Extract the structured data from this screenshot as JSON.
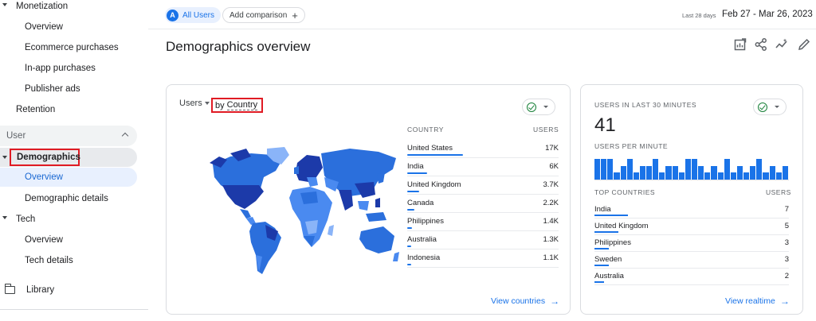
{
  "sidebar": {
    "monetization": "Monetization",
    "overview_1": "Overview",
    "ecommerce": "Ecommerce purchases",
    "inapp": "In-app purchases",
    "publisher": "Publisher ads",
    "retention": "Retention",
    "user_section": "User",
    "demographics": "Demographics",
    "overview_2": "Overview",
    "demo_details": "Demographic details",
    "tech": "Tech",
    "overview_3": "Overview",
    "tech_details": "Tech details",
    "library": "Library"
  },
  "topbar": {
    "all_users_avatar": "A",
    "all_users": "All Users",
    "add_comparison": "Add comparison",
    "date_hint": "Last 28 days",
    "date_range": "Feb 27 - Mar 26, 2023"
  },
  "page_title": "Demographics overview",
  "country_card": {
    "metric": "Users",
    "by_prefix": "by",
    "by_dimension": "Country",
    "col_country": "COUNTRY",
    "col_users": "USERS",
    "rows": [
      {
        "name": "United States",
        "value": "17K",
        "share": 1.0
      },
      {
        "name": "India",
        "value": "6K",
        "share": 0.353
      },
      {
        "name": "United Kingdom",
        "value": "3.7K",
        "share": 0.218
      },
      {
        "name": "Canada",
        "value": "2.2K",
        "share": 0.129
      },
      {
        "name": "Philippines",
        "value": "1.4K",
        "share": 0.082
      },
      {
        "name": "Australia",
        "value": "1.3K",
        "share": 0.076
      },
      {
        "name": "Indonesia",
        "value": "1.1K",
        "share": 0.065
      }
    ],
    "link": "View countries"
  },
  "realtime_card": {
    "label_users": "USERS IN LAST 30 MINUTES",
    "users_count": "41",
    "label_per_minute": "USERS PER MINUTE",
    "per_minute": [
      3,
      3,
      3,
      1,
      2,
      3,
      1,
      2,
      2,
      3,
      1,
      2,
      2,
      1,
      3,
      3,
      2,
      1,
      2,
      1,
      3,
      1,
      2,
      1,
      2,
      3,
      1,
      2,
      1,
      2
    ],
    "col_top": "TOP COUNTRIES",
    "col_users": "USERS",
    "rows": [
      {
        "name": "India",
        "value": "7",
        "share": 1.0
      },
      {
        "name": "United Kingdom",
        "value": "5",
        "share": 0.714
      },
      {
        "name": "Philippines",
        "value": "3",
        "share": 0.429
      },
      {
        "name": "Sweden",
        "value": "3",
        "share": 0.429
      },
      {
        "name": "Australia",
        "value": "2",
        "share": 0.286
      }
    ],
    "link": "View realtime"
  },
  "colors": {
    "accent": "#1a73e8",
    "highlight": "#e01b24",
    "map_dark": "#1c3aa9",
    "map_mid": "#2b6fdc",
    "map_light": "#8ab4f8"
  }
}
